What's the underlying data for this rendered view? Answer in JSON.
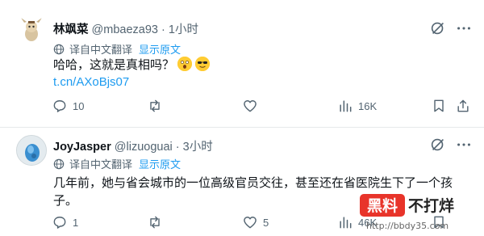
{
  "tweets": [
    {
      "display_name": "林飒菜",
      "handle": "@mbaeza93",
      "dot": "·",
      "time": "1小时",
      "translate_label": "译自中文翻译",
      "show_original": "显示原文",
      "text": "哈哈，这就是真相吗？",
      "link": "t.cn/AXoBjs07",
      "actions": {
        "replies": "10",
        "retweets": "",
        "likes": "",
        "views": "16K"
      }
    },
    {
      "display_name": "JoyJasper",
      "handle": "@lizuoguai",
      "dot": "·",
      "time": "3小时",
      "translate_label": "译自中文翻译",
      "show_original": "显示原文",
      "text": "几年前，她与省会城市的一位高级官员交往，甚至还在省医院生下了一个孩子。",
      "actions": {
        "replies": "1",
        "retweets": "",
        "likes": "5",
        "views": "46K"
      }
    }
  ],
  "watermark": {
    "brand": "黑料不打烊",
    "url": "http://bbdy35.com"
  },
  "colors": {
    "link": "#1d9bf0",
    "muted": "#536471",
    "text": "#0f1419"
  }
}
